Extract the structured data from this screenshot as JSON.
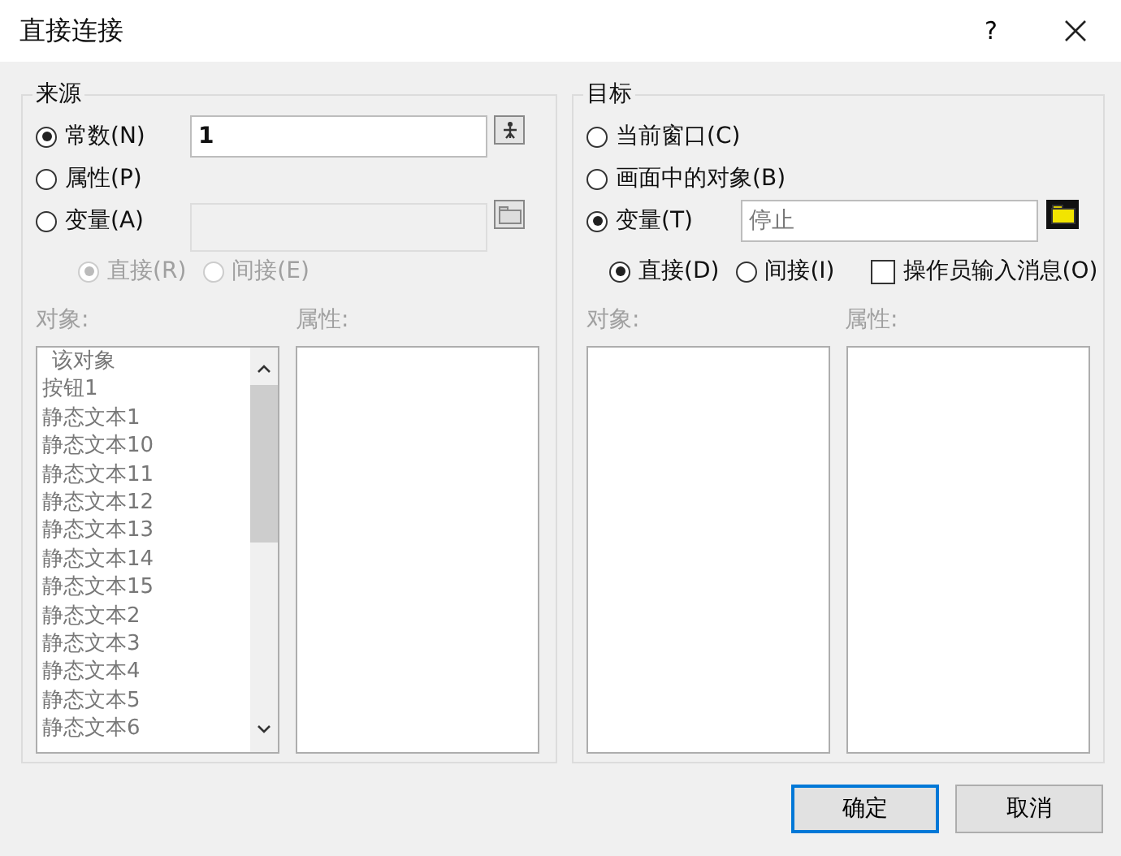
{
  "window": {
    "title": "直接连接",
    "help": "?"
  },
  "source": {
    "legend": "来源",
    "modes": [
      {
        "label": "常数(N)",
        "selected": true,
        "field": {
          "value": "1",
          "disabled": false,
          "kind": "constant"
        }
      },
      {
        "label": "属性(P)",
        "selected": false
      },
      {
        "label": "变量(A)",
        "selected": false,
        "field": {
          "disabled": true,
          "kind": "browse"
        }
      }
    ],
    "access": [
      {
        "label": "直接(R)",
        "selected": true,
        "disabled": true
      },
      {
        "label": "间接(E)",
        "selected": false,
        "disabled": true
      }
    ],
    "object_label": "对象:",
    "property_label": "属性:",
    "labels_disabled": true,
    "objects": [
      {
        "text": "该对象",
        "kind": "self"
      },
      {
        "text": "按钮1",
        "kind": "item"
      },
      {
        "text": "静态文本1",
        "kind": "item"
      },
      {
        "text": "静态文本10",
        "kind": "item"
      },
      {
        "text": "静态文本11",
        "kind": "item"
      },
      {
        "text": "静态文本12",
        "kind": "item"
      },
      {
        "text": "静态文本13",
        "kind": "item"
      },
      {
        "text": "静态文本14",
        "kind": "item"
      },
      {
        "text": "静态文本15",
        "kind": "item"
      },
      {
        "text": "静态文本2",
        "kind": "item"
      },
      {
        "text": "静态文本3",
        "kind": "item"
      },
      {
        "text": "静态文本4",
        "kind": "item"
      },
      {
        "text": "静态文本5",
        "kind": "item"
      },
      {
        "text": "静态文本6",
        "kind": "item"
      }
    ]
  },
  "target": {
    "legend": "目标",
    "modes": [
      {
        "label": "当前窗口(C)",
        "selected": false
      },
      {
        "label": "画面中的对象(B)",
        "selected": false
      },
      {
        "label": "变量(T)",
        "selected": true,
        "field": {
          "value": "停止",
          "disabled": false,
          "kind": "folder"
        }
      }
    ],
    "access": [
      {
        "label": "直接(D)",
        "selected": true,
        "disabled": false
      },
      {
        "label": "间接(I)",
        "selected": false,
        "disabled": false
      }
    ],
    "operator_message": {
      "label": "操作员输入消息(O)",
      "checked": false
    },
    "object_label": "对象:",
    "property_label": "属性:",
    "labels_disabled": true
  },
  "buttons": [
    {
      "label": "确定",
      "default": true
    },
    {
      "label": "取消",
      "default": false
    }
  ]
}
